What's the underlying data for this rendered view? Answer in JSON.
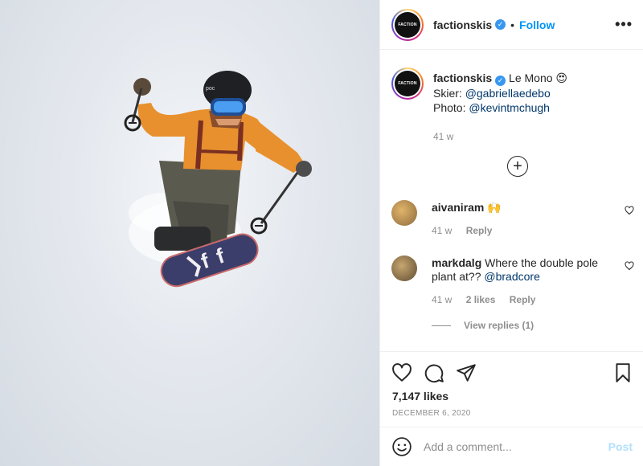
{
  "header": {
    "username": "factionskis",
    "verified_icon": "verified-badge-icon",
    "separator": "•",
    "follow_label": "Follow",
    "more_icon": "more-options-icon",
    "more_glyph": "•••",
    "avatar_text": "FACTION"
  },
  "caption": {
    "username": "factionskis",
    "title": "Le Mono",
    "emoji": "😍",
    "skier_label": "Skier:",
    "skier_handle": "@gabriellaedebo",
    "photo_label": "Photo:",
    "photo_handle": "@kevintmchugh",
    "age": "41 w"
  },
  "load_more_icon": "plus-circle-icon",
  "comments": [
    {
      "username": "aivaniram",
      "text": "🙌",
      "mention": "",
      "age": "41 w",
      "likes": "",
      "reply_label": "Reply"
    },
    {
      "username": "markdalg",
      "text": "Where the double pole plant at??",
      "mention": "@bradcore",
      "age": "41 w",
      "likes": "2 likes",
      "reply_label": "Reply"
    }
  ],
  "view_replies": "View replies (1)",
  "actions": {
    "like_icon": "heart-icon",
    "comment_icon": "comment-bubble-icon",
    "share_icon": "paper-plane-icon",
    "save_icon": "bookmark-icon"
  },
  "likes": "7,147 likes",
  "date": "DECEMBER 6, 2020",
  "add_comment": {
    "emoji_icon": "smiley-icon",
    "placeholder": "Add a comment...",
    "post_label": "Post"
  },
  "colors": {
    "accent": "#0095f6",
    "verified": "#3897f0",
    "jacket": "#e8902e",
    "snow": "#e4e8ee",
    "board_base": "#3b3e6a"
  }
}
